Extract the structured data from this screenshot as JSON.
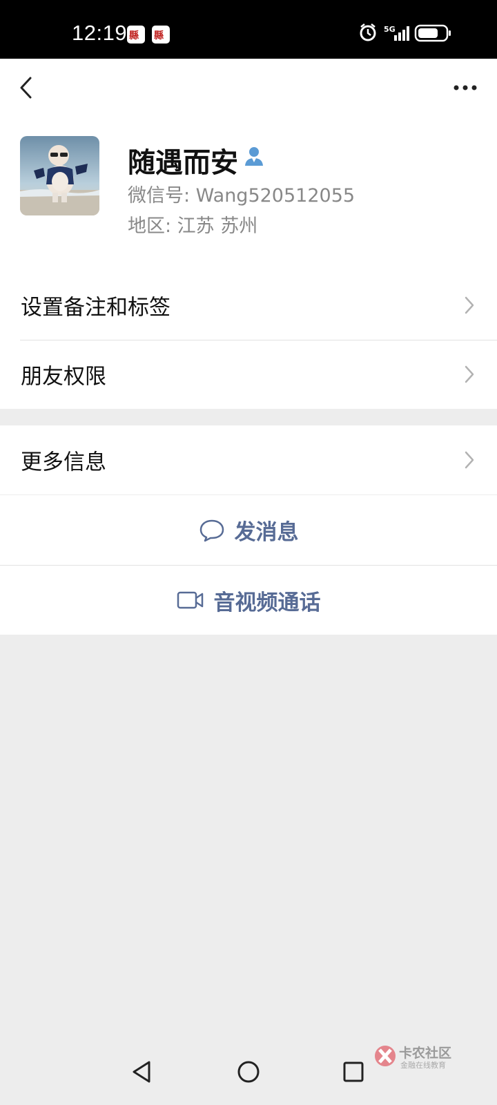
{
  "status_bar": {
    "time": "12:19",
    "network": "5G",
    "icons": [
      "app-notification-icon",
      "app-notification-icon",
      "alarm-icon",
      "signal-icon",
      "battery-icon"
    ]
  },
  "nav": {
    "back_icon": "chevron-left-icon",
    "more_icon": "more-dots-icon"
  },
  "profile": {
    "name": "随遇而安",
    "wechat_id": "微信号: Wang520512055",
    "region": "地区: 江苏  苏州",
    "friend_icon": "person-icon"
  },
  "menu_section_1": [
    {
      "label": "设置备注和标签"
    },
    {
      "label": "朋友权限"
    }
  ],
  "menu_section_2": [
    {
      "label": "更多信息"
    }
  ],
  "actions": [
    {
      "label": "发消息",
      "icon": "chat-bubble-icon"
    },
    {
      "label": "音视频通话",
      "icon": "video-camera-icon"
    }
  ],
  "watermark": {
    "title": "卡农社区",
    "subtitle": "金融在线教育"
  },
  "colors": {
    "accent": "#576b95",
    "background": "#ededed",
    "status_bar": "#000000"
  }
}
